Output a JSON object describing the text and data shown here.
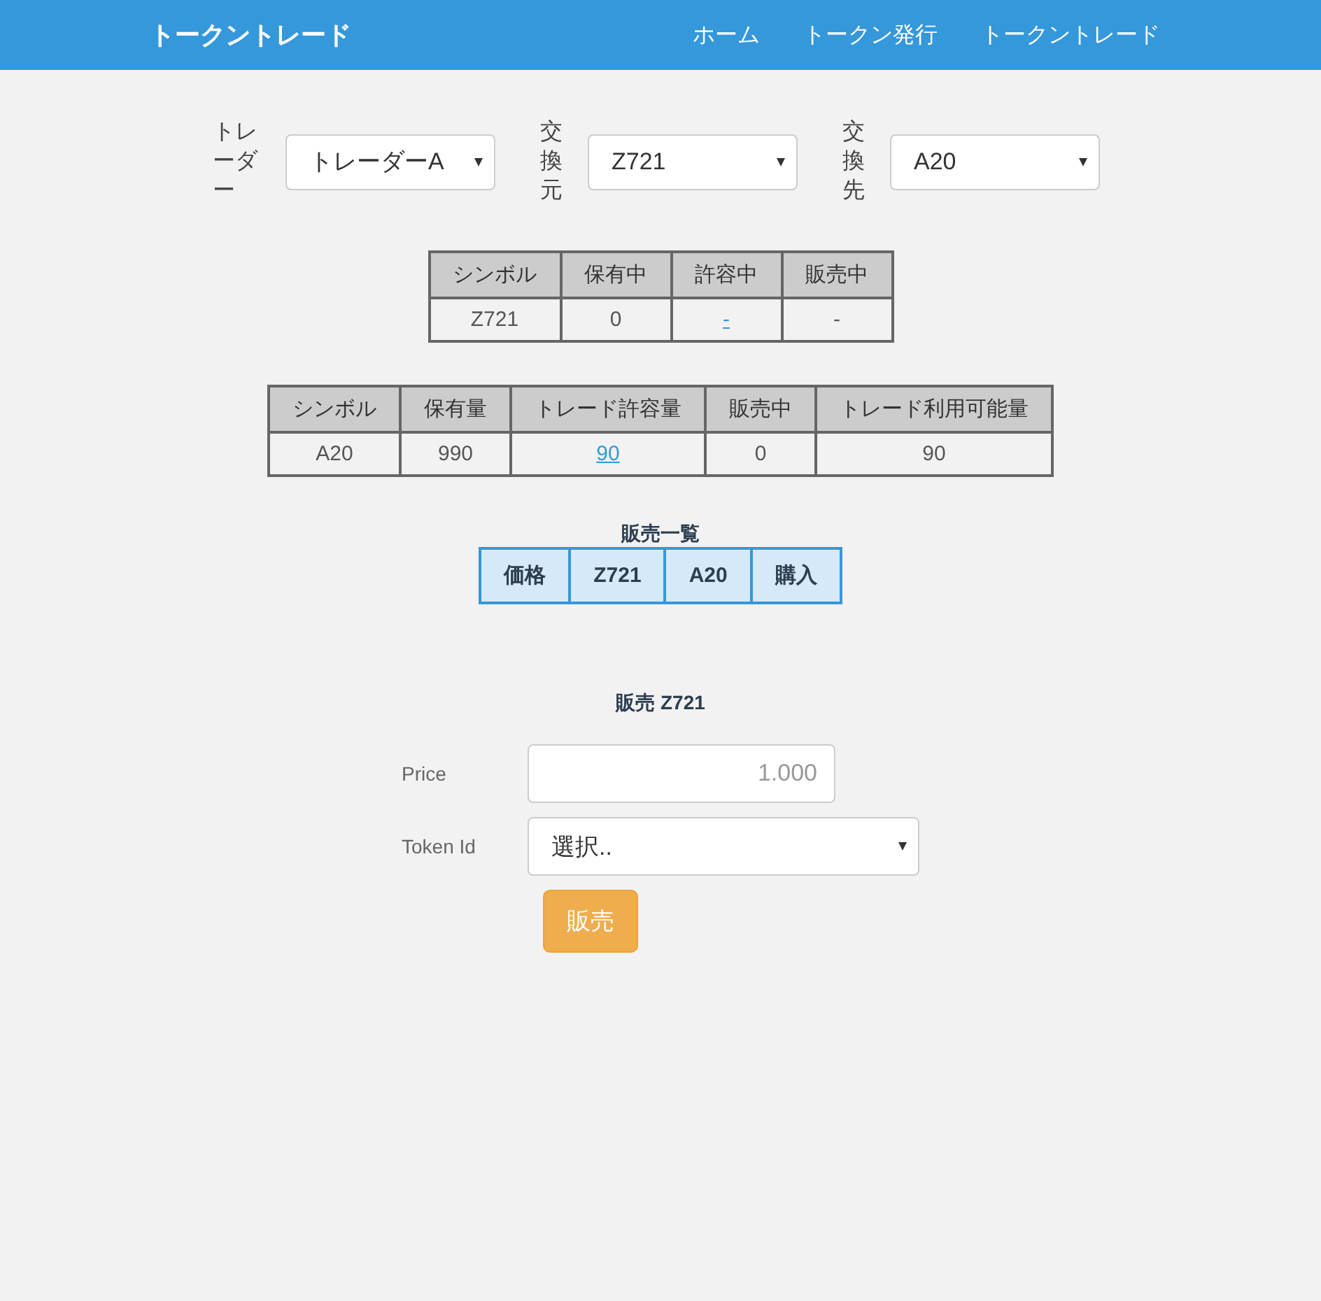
{
  "navbar": {
    "brand": "トークントレード",
    "links": [
      {
        "label": "ホーム"
      },
      {
        "label": "トークン発行"
      },
      {
        "label": "トークントレード"
      }
    ]
  },
  "selectors": [
    {
      "label": "トレーダー",
      "value": "トレーダーA"
    },
    {
      "label": "交換元",
      "value": "Z721"
    },
    {
      "label": "交換先",
      "value": "A20"
    }
  ],
  "tables": [
    {
      "columns": [
        "シンボル",
        "保有中",
        "許容中",
        "販売中"
      ],
      "rows": [
        [
          {
            "text": "Z721",
            "kind": "text"
          },
          {
            "text": "0",
            "kind": "text"
          },
          {
            "text": "-",
            "kind": "link"
          },
          {
            "text": "-",
            "kind": "text"
          }
        ]
      ]
    },
    {
      "columns": [
        "シンボル",
        "保有量",
        "トレード許容量",
        "販売中",
        "トレード利用可能量"
      ],
      "rows": [
        [
          {
            "text": "A20",
            "kind": "text"
          },
          {
            "text": "990",
            "kind": "text"
          },
          {
            "text": "90",
            "kind": "link"
          },
          {
            "text": "0",
            "kind": "text"
          },
          {
            "text": "90",
            "kind": "text"
          }
        ]
      ]
    }
  ],
  "sales_list": {
    "title": "販売一覧",
    "columns": [
      "価格",
      "Z721",
      "A20",
      "購入"
    ]
  },
  "sell_form": {
    "title": "販売 Z721",
    "fields": [
      {
        "label": "Price",
        "kind": "input",
        "placeholder": "1.000"
      },
      {
        "label": "Token Id",
        "kind": "select",
        "value": "選択.."
      }
    ],
    "button": "販売"
  }
}
